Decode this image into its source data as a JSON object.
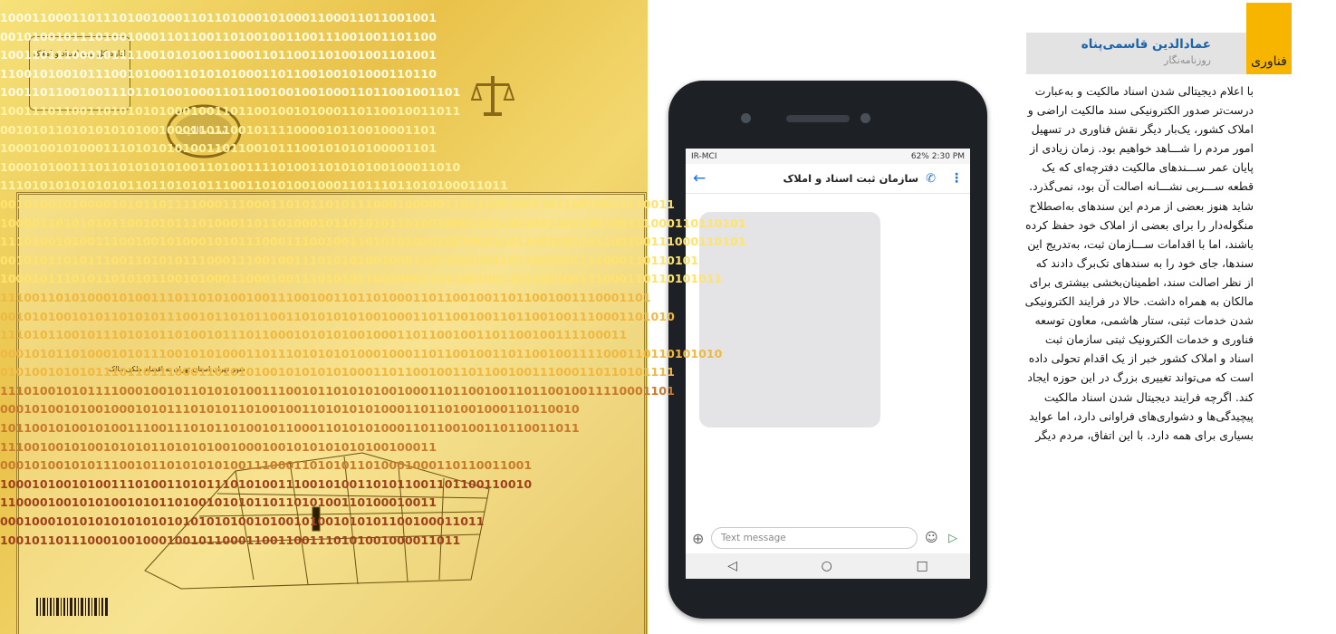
{
  "deed": {
    "binary_rows": [
      "1000110001101110100100011011010001010001100011011001001",
      "0010100101110100100011011001101001001100111001001101100",
      "1001101110001011110010101001100011011001101001001101001",
      "1100101001011100101000110101010001101100100101000110110",
      "1001101100100111011010010001101100100100100011011001001101",
      "1001110110011010101010001001101100100101000110110010011011",
      "0010101101010101010010001101100101111000010110010001101",
      "1000100101000111010101010011011001011100101010100001101",
      "1000101001110110101010100110100111101001101010100100011010",
      "1110101010101010110110101011100110101001000110111011010100011011",
      "0010100101000010101101111000111000110101101011100010000011011100100110110010011110011",
      "1000011010101011001010111010001101101000101101010110100100011011001001101100100111000110110101",
      "1110100101001110010010100010101110001110010011010101010100100011011001001101100100111000110101",
      "0010101101011100110101011100011100100111010101001000110110010011011001001111000110110101",
      "1000101110101101010110010100011000100111010101100100011011001001101100100111000110110101011",
      "1110011010100010100111011010100100111001001101101000110110010011011001001110001101",
      "0010101001010110101011100101101011001101010101001000110110010011011001001110001101010",
      "1110101100101110101011010010111011000101010100100011011001001101100100111100011",
      "0001010110100010101110010101000110111010101010001000110110010011011001001111000110110101010",
      "0101001010101110110111000110101010010101010100011011001001101100100111000110110101111",
      "1110100101011110001001011010101001110010110101010010001101100100110110010011110001101",
      "0001010010100100010101110101011010010011010101010001101101001000110110010",
      "1011001010010100111001110101101001011000110101010001101100100110110011011",
      "1110010010100101010110101010010001001010101010100100011",
      "0001010010101110010110101010100111000110101011010001000110110011001",
      "1000101001010011101001101011101010011100101001101011001101100110010",
      "1100001001010100101011010010101011011010100110100010011",
      "0001000101010101010101010101010010100101001010101100100011011",
      "1001011011100010010001001011000110011001110101001000011011"
    ],
    "stamp_text": "اداره کل ثبت اسناد و املاک",
    "seal_text": "سند مالکیت",
    "map_caption": "شهر تهران استان تهران به اقسام ملکی مالک"
  },
  "phone": {
    "status_carrier": "IR-MCI",
    "status_right": "62% 2:30 PM",
    "title": "سازمان ثبت اسناد و املاک",
    "input_placeholder": "Text message",
    "binary_in_bubble": true
  },
  "byline": {
    "tag": "فناوری",
    "author": "عمادالدین قاسمی‌پناه",
    "role": "روزنامه‌نگار"
  },
  "article": {
    "lines": [
      "با اعلام دیجیتالی شدن اسناد مالکیت و به‌عبارت",
      "درست‌تر صدور الکترونیکی سند مالکیت اراضی و",
      "املاک کشور، یک‌بار دیگر نقش فناوری در تسهیل",
      "امور مردم را شـــاهد خواهیم بود. زمان زیادی از",
      "پایان عمر ســـندهای مالکیت دفترچه‌ای که یک",
      "قطعه ســـربی نشـــانه اصالت آن بود، نمی‌گذرد.",
      "شاید هنوز بعضی از مردم این سندهای به‌اصطلاح",
      "منگوله‌دار را برای بعضی از املاک خود حفظ کرده",
      "باشند، اما با اقدامات ســـازمان ثبت، به‌تدریج این",
      "سندها، جای خود را به سندهای تک‌برگ دادند که",
      "از نظر اصالت سند، اطمینان‌بخشی بیشتری برای",
      "مالکان به همراه داشت. حالا در فرایند الکترونیکی",
      "شدن خدمات ثبتی، ستار هاشمی، معاون توسعه",
      "فناوری و خدمات الکترونیک ثبتی سازمان ثبت",
      "اسناد و املاک کشور خبر از یک اقدام تحولی داده",
      "است که می‌تواند تغییری بزرگ در این حوزه ایجاد",
      "کند. اگرچه فرایند دیجیتال شدن اسناد مالکیت",
      "پیچیدگی‌ها و دشواری‌های فراوانی دارد، اما عواید",
      "بسیاری برای همه دارد. با این اتفاق، مردم دیگر"
    ]
  }
}
